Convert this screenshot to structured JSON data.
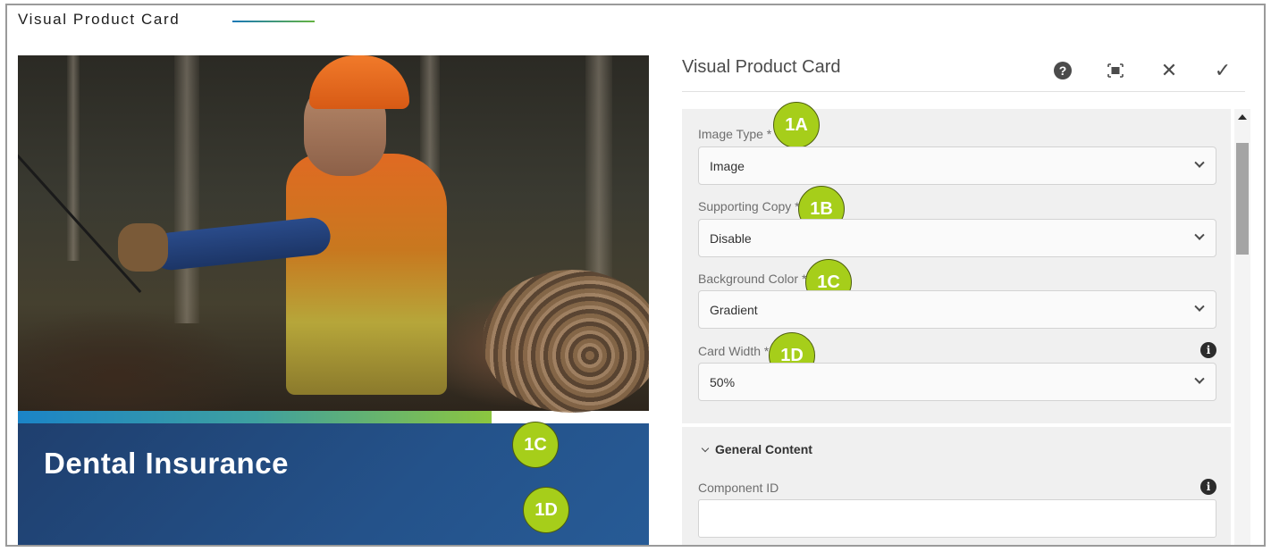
{
  "page": {
    "title": "Visual Product Card"
  },
  "preview": {
    "heading": "Dental Insurance",
    "badges": {
      "bg_color": "1C",
      "card_width": "1D"
    }
  },
  "dialog": {
    "title": "Visual Product Card",
    "toolbar": {
      "help_icon": "help-icon",
      "fullscreen_icon": "fullscreen-icon",
      "close_icon": "close-icon",
      "done_icon": "check-icon"
    },
    "fields": [
      {
        "label": "Image Type *",
        "value": "Image",
        "badge": "1A"
      },
      {
        "label": "Supporting Copy *",
        "value": "Disable",
        "badge": "1B"
      },
      {
        "label": "Background Color *",
        "value": "Gradient",
        "badge": "1C"
      },
      {
        "label": "Card Width *",
        "value": "50%",
        "badge": "1D"
      }
    ],
    "section": {
      "label": "General Content"
    },
    "component_id": {
      "label": "Component ID",
      "value": ""
    }
  },
  "colors": {
    "badge": "#a6ce1a",
    "card_bg": "#24528a",
    "accent_start": "#1b84c7",
    "accent_end": "#8cc63f"
  }
}
